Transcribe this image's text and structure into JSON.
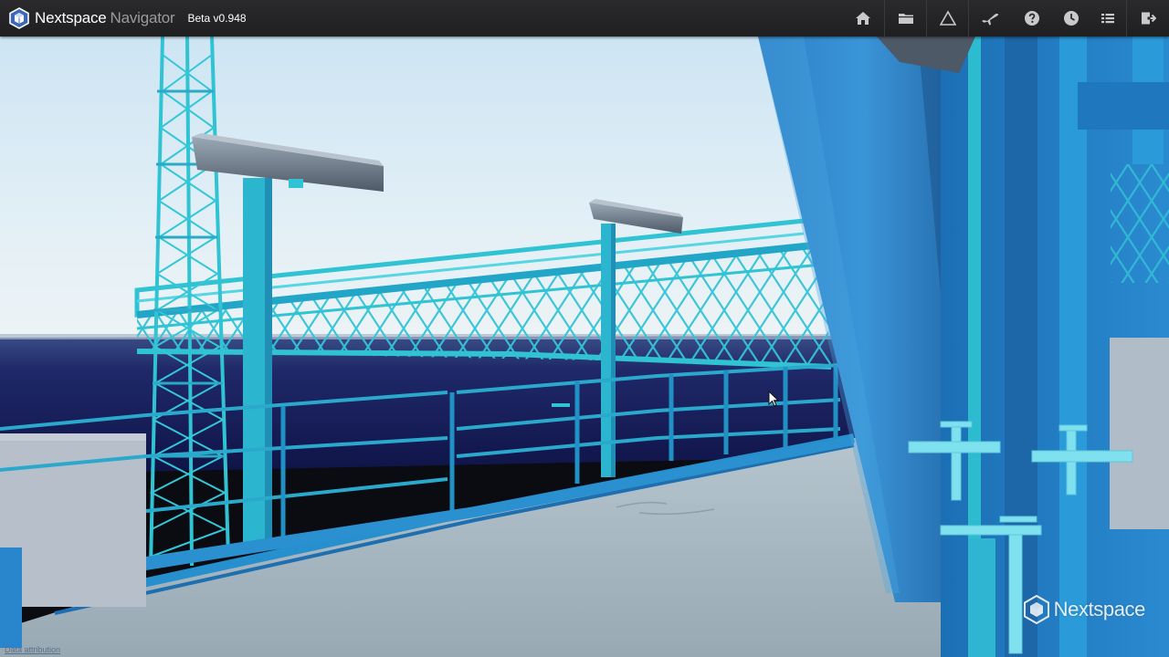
{
  "app": {
    "brand_name": "Nextspace",
    "product_name": "Navigator",
    "version": "Beta v0.948"
  },
  "toolbar": {
    "buttons": [
      {
        "name": "home-button",
        "icon": "home-icon"
      },
      {
        "name": "projects-button",
        "icon": "folder-icon"
      },
      {
        "name": "measure-button",
        "icon": "triangle-icon"
      },
      {
        "name": "flythrough-button",
        "icon": "airplane-icon"
      },
      {
        "name": "help-button",
        "icon": "help-icon"
      },
      {
        "name": "history-button",
        "icon": "clock-icon"
      },
      {
        "name": "menu-button",
        "icon": "list-icon"
      },
      {
        "name": "sign-out-button",
        "icon": "sign-out-icon"
      }
    ]
  },
  "viewport": {
    "watermark_text": "Nextspace",
    "attribution_text": "Data attribution"
  },
  "colors": {
    "topbar": "#252527",
    "icon": "#c9c9cc",
    "structure_cyan": "#2fc3d3",
    "structure_blue": "#1d7fc4",
    "sky_top": "#cfe6f4",
    "sea": "#161a55",
    "deck": "#a6b6c2"
  }
}
